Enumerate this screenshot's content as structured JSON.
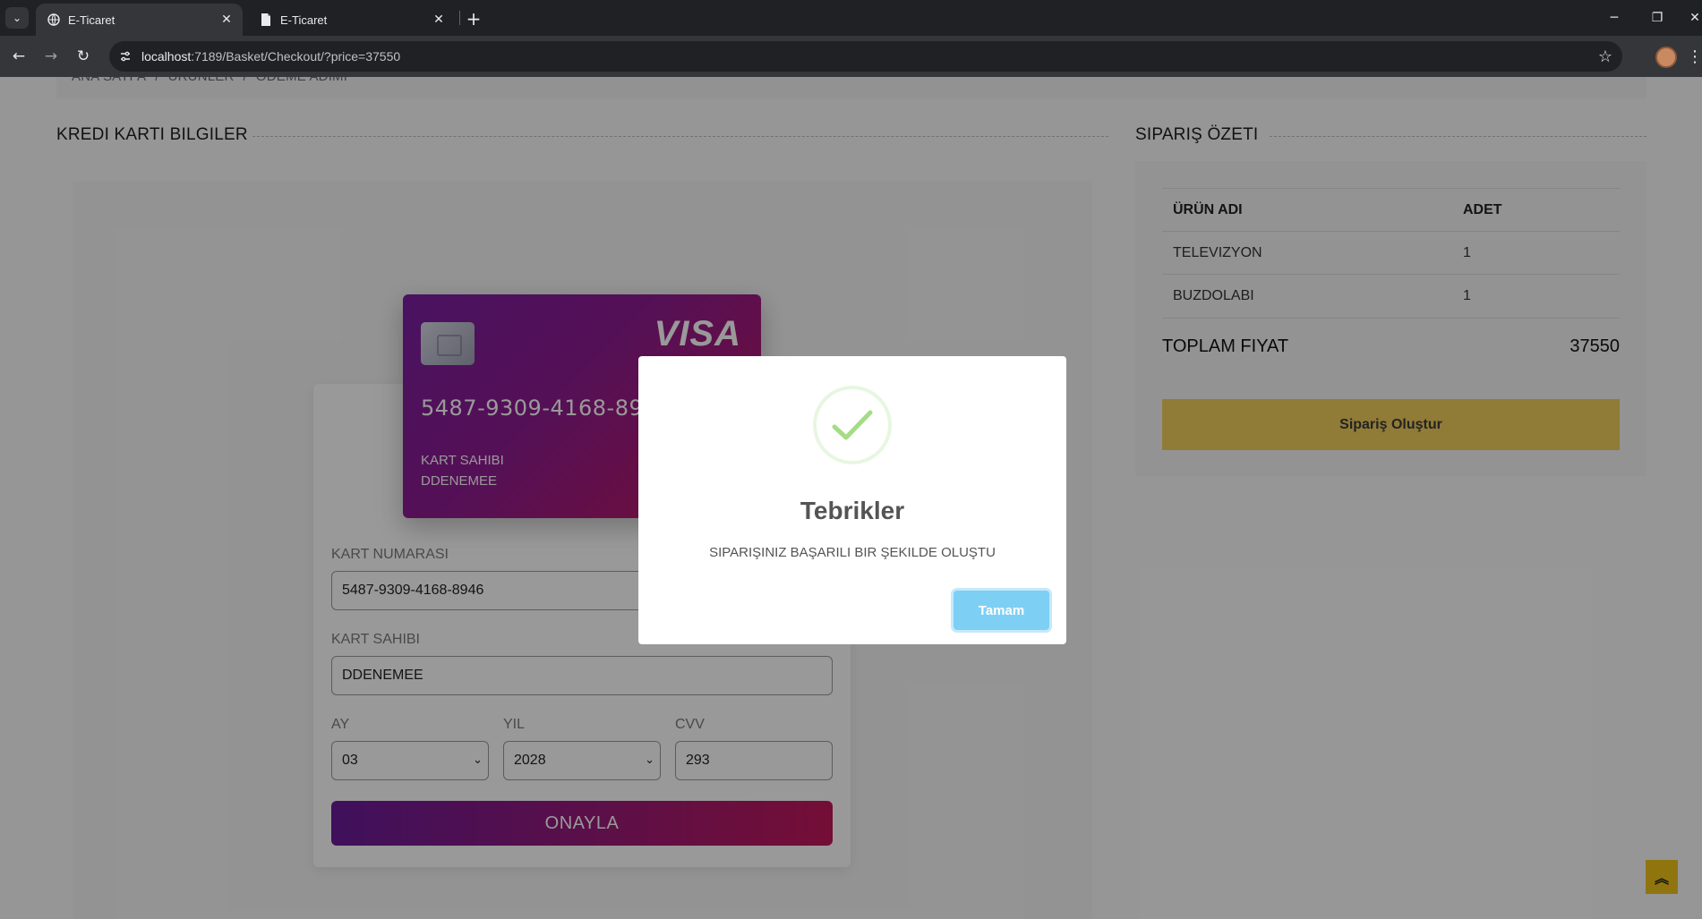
{
  "browser": {
    "tabs": [
      {
        "title": "E-Ticaret",
        "active": true
      },
      {
        "title": "E-Ticaret",
        "active": false
      }
    ],
    "url_host": "localhost",
    "url_path": ":7189/Basket/Checkout/?price=37550"
  },
  "breadcrumb": {
    "items": [
      "ANA SAYFA",
      "ÜRÜNLER",
      "ÖDEME ADIMI"
    ],
    "separator": "/"
  },
  "payment": {
    "section_title": "KREDI KARTI BILGILER",
    "card": {
      "brand": "VISA",
      "number": "5487-9309-4168-8946",
      "holder_label": "KART SAHIBI",
      "holder_name": "DDENEMEE"
    },
    "form": {
      "card_number_label": "KART NUMARASI",
      "card_number_value": "5487-9309-4168-8946",
      "holder_label": "KART SAHIBI",
      "holder_value": "DDENEMEE",
      "month_label": "AY",
      "month_value": "03",
      "year_label": "YIL",
      "year_value": "2028",
      "cvv_label": "CVV",
      "cvv_value": "293",
      "submit_label": "ONAYLA"
    }
  },
  "summary": {
    "section_title": "SIPARIŞ ÖZETI",
    "columns": [
      "ÜRÜN ADI",
      "ADET"
    ],
    "rows": [
      {
        "name": "TELEVIZYON",
        "qty": "1"
      },
      {
        "name": "BUZDOLABI",
        "qty": "1"
      }
    ],
    "total_label": "TOPLAM FIYAT",
    "total_value": "37550",
    "order_button": "Sipariş Oluştur"
  },
  "modal": {
    "title": "Tebrikler",
    "text": "SIPARIŞINIZ BAŞARILI BIR ŞEKILDE OLUŞTU",
    "button": "Tamam"
  },
  "colors": {
    "accent_yellow": "#f0ce5c",
    "card_gradient_start": "#7b1fa2",
    "card_gradient_end": "#c2185b",
    "modal_button": "#7ecff4",
    "success_green": "#a5dc86"
  },
  "icons": [
    "chevron-down-icon",
    "globe-icon",
    "document-icon",
    "close-icon",
    "plus-icon",
    "back-icon",
    "forward-icon",
    "reload-icon",
    "site-info-icon",
    "star-icon",
    "checkmark-icon",
    "double-chevron-up-icon"
  ]
}
